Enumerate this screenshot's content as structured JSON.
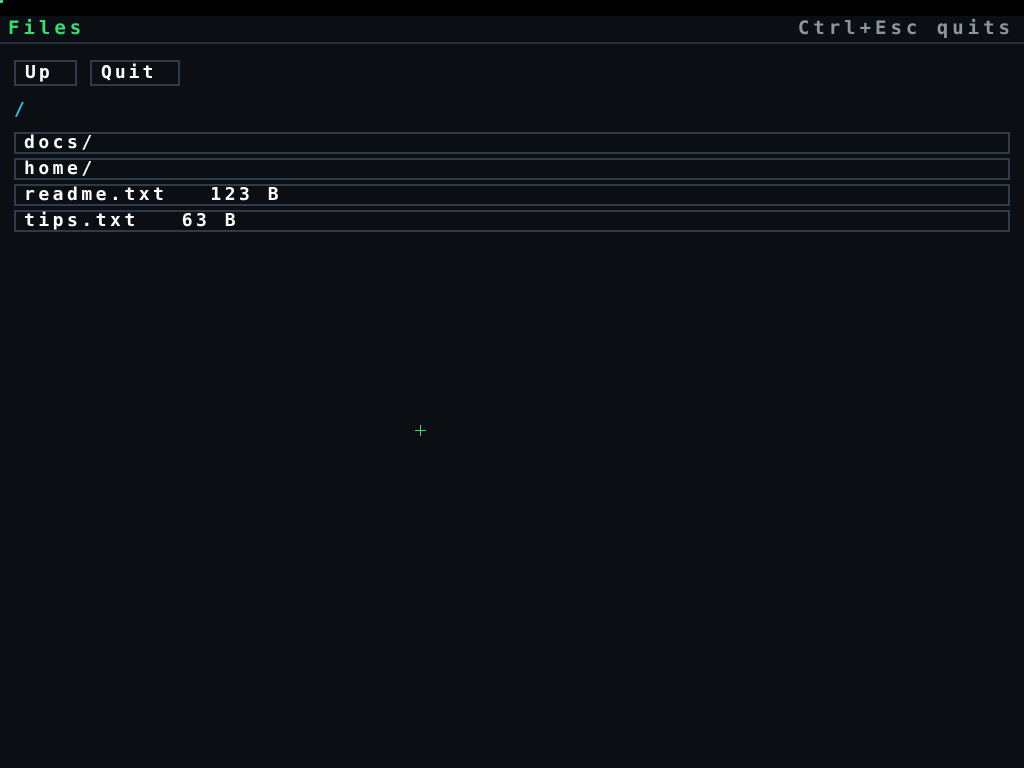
{
  "header": {
    "title": "Files",
    "hint": "Ctrl+Esc quits"
  },
  "toolbar": {
    "up_label": "Up",
    "quit_label": "Quit"
  },
  "path": {
    "current": "/"
  },
  "files": [
    {
      "label": "docs/"
    },
    {
      "label": "home/"
    },
    {
      "label": "readme.txt   123 B"
    },
    {
      "label": "tips.txt   63 B"
    }
  ],
  "colors": {
    "background": "#0b0f14",
    "accent": "#33e070",
    "path": "#20c8f0",
    "border": "#2f3b46",
    "hint": "#8c96a0",
    "text": "#ffffff"
  },
  "icons": {
    "pointer": "crosshair-cursor-icon"
  }
}
